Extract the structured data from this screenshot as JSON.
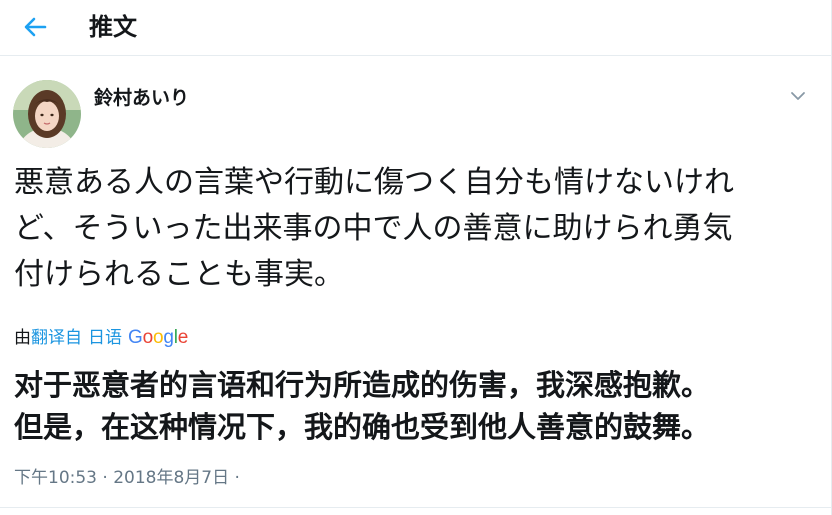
{
  "header": {
    "title": "推文",
    "back_icon": "arrow-left-icon"
  },
  "tweet": {
    "author_name": "鈴村あいり",
    "caret_icon": "chevron-down-icon",
    "text_lines": [
      "悪意ある人の言葉や行動に傷つく自分も情けないけれ",
      "ど、そういった出来事の中で人の善意に助けられ勇気",
      "付けられることも事実。"
    ],
    "translation": {
      "prefix": "由",
      "link": "翻译自",
      "language": "日语",
      "provider": "Google",
      "text_lines": [
        "对于恶意者的言语和行为所造成的伤害，我深感抱歉。",
        "但是，在这种情况下，我的确也受到他人善意的鼓舞。"
      ]
    },
    "time": "下午10:53",
    "separator": " · ",
    "date": "2018年8月7日",
    "trailing_separator": " ·"
  },
  "colors": {
    "link": "#1b95e0",
    "meta": "#657786",
    "text": "#14171a",
    "divider": "#e6ecf0"
  }
}
